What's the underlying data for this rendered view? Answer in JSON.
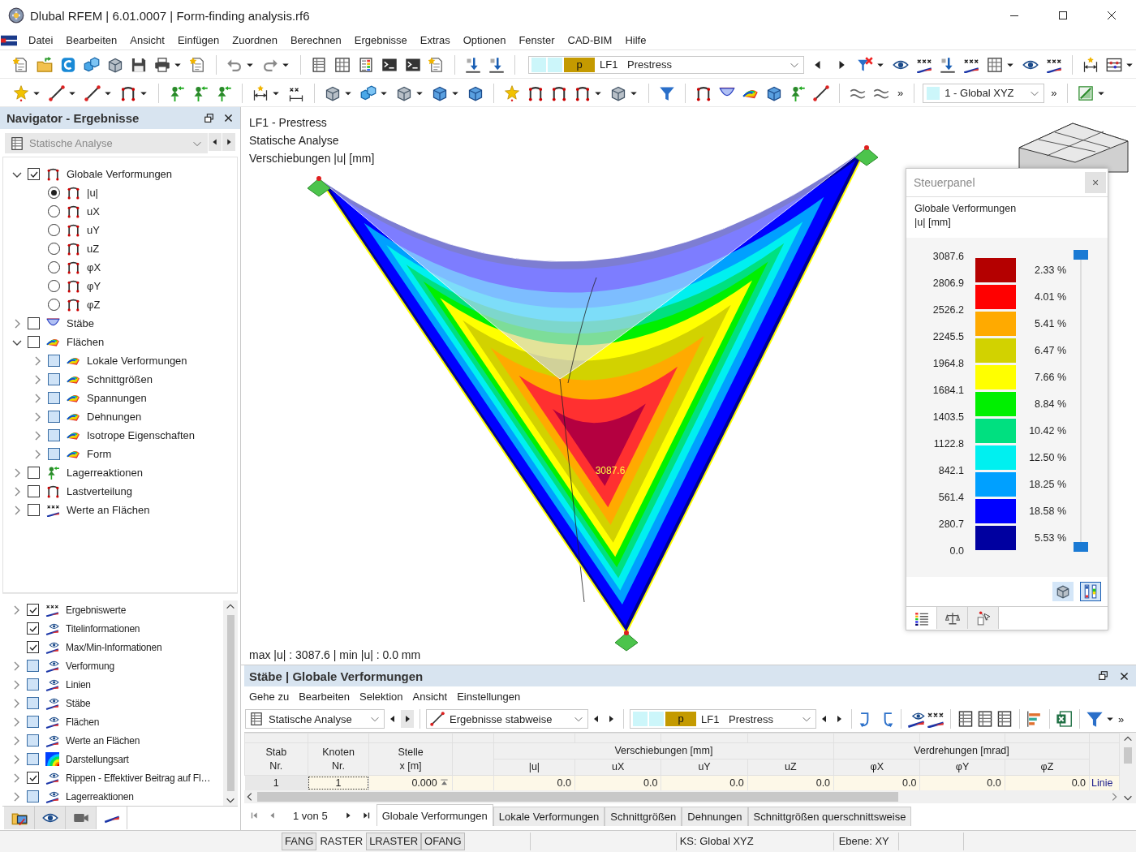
{
  "window": {
    "title": "Dlubal RFEM | 6.01.0007 | Form-finding analysis.rf6"
  },
  "menu": [
    "Datei",
    "Bearbeiten",
    "Ansicht",
    "Einfügen",
    "Zuordnen",
    "Berechnen",
    "Ergebnisse",
    "Extras",
    "Optionen",
    "Fenster",
    "CAD-BIM",
    "Hilfe"
  ],
  "toolbar_1": {
    "load_case": {
      "type": "p",
      "number": "LF1",
      "name": "Prestress"
    }
  },
  "toolbar_2": {
    "coordinate_system": "1 - Global XYZ",
    "overflow": [
      "»",
      "»"
    ]
  },
  "navigator": {
    "title": "Navigator - Ergebnisse",
    "analysis": {
      "value": "Statische Analyse",
      "disabled": true
    },
    "tree": [
      {
        "label": "Globale Verformungen",
        "kind": "deformation",
        "checked": true,
        "tinted": false,
        "expanded": true,
        "children": [
          {
            "label": "|u|",
            "kind": "deformation",
            "selected": true
          },
          {
            "label": "uX",
            "kind": "deformation",
            "selected": false
          },
          {
            "label": "uY",
            "kind": "deformation",
            "selected": false
          },
          {
            "label": "uZ",
            "kind": "deformation",
            "selected": false
          },
          {
            "label": "φX",
            "kind": "deformation",
            "selected": false
          },
          {
            "label": "φY",
            "kind": "deformation",
            "selected": false
          },
          {
            "label": "φZ",
            "kind": "deformation",
            "selected": false
          }
        ]
      },
      {
        "label": "Stäbe",
        "kind": "member",
        "checked": false,
        "tinted": false,
        "expanded": false
      },
      {
        "label": "Flächen",
        "kind": "surface",
        "checked": false,
        "tinted": false,
        "expanded": true,
        "children": [
          {
            "label": "Lokale Verformungen",
            "kind": "surface",
            "checked": false,
            "tinted": true,
            "expanded": false
          },
          {
            "label": "Schnittgrößen",
            "kind": "surface",
            "checked": false,
            "tinted": true,
            "expanded": false
          },
          {
            "label": "Spannungen",
            "kind": "surface",
            "checked": false,
            "tinted": true,
            "expanded": false
          },
          {
            "label": "Dehnungen",
            "kind": "surface",
            "checked": false,
            "tinted": true,
            "expanded": false
          },
          {
            "label": "Isotrope Eigenschaften",
            "kind": "surface",
            "checked": false,
            "tinted": true,
            "expanded": false
          },
          {
            "label": "Form",
            "kind": "surface",
            "checked": false,
            "tinted": true,
            "expanded": false
          }
        ]
      },
      {
        "label": "Lagerreaktionen",
        "kind": "support",
        "checked": false,
        "tinted": false,
        "expanded": false
      },
      {
        "label": "Lastverteilung",
        "kind": "deformation",
        "checked": false,
        "tinted": false,
        "expanded": false
      },
      {
        "label": "Werte an Flächen",
        "kind": "values",
        "checked": false,
        "tinted": false,
        "expanded": false
      }
    ],
    "display_tree": [
      {
        "label": "Ergebniswerte",
        "kind": "result-values",
        "checked": true,
        "tinted": false,
        "expanded": false
      },
      {
        "label": "Titelinformationen",
        "kind": "display",
        "checked": true,
        "tinted": false
      },
      {
        "label": "Max/Min-Informationen",
        "kind": "display",
        "checked": true,
        "tinted": false
      },
      {
        "label": "Verformung",
        "kind": "display",
        "checked": false,
        "tinted": true,
        "expanded": false
      },
      {
        "label": "Linien",
        "kind": "display",
        "checked": false,
        "tinted": true,
        "expanded": false
      },
      {
        "label": "Stäbe",
        "kind": "display",
        "checked": false,
        "tinted": true,
        "expanded": false
      },
      {
        "label": "Flächen",
        "kind": "display",
        "checked": false,
        "tinted": true,
        "expanded": false
      },
      {
        "label": "Werte an Flächen",
        "kind": "display",
        "checked": false,
        "tinted": true,
        "expanded": false
      },
      {
        "label": "Darstellungsart",
        "kind": "color-scale",
        "checked": false,
        "tinted": true,
        "expanded": false
      },
      {
        "label": "Rippen - Effektiver Beitrag auf Fl…",
        "kind": "display",
        "checked": true,
        "tinted": false,
        "expanded": false
      },
      {
        "label": "Lagerreaktionen",
        "kind": "display",
        "checked": false,
        "tinted": true,
        "expanded": false
      }
    ],
    "tabs": [
      {
        "kind": "data",
        "selected": false
      },
      {
        "kind": "view",
        "selected": false
      },
      {
        "kind": "camera",
        "selected": false
      },
      {
        "kind": "display",
        "selected": true
      }
    ]
  },
  "viewport": {
    "title_lines": [
      "LF1 - Prestress",
      "Statische Analyse",
      "Verschiebungen |u| [mm]"
    ],
    "max_label": "3087.6",
    "summary": "max |u| : 3087.6 | min |u| : 0.0 mm"
  },
  "control_panel": {
    "title": "Steuerpanel",
    "close": "×",
    "heading": "Globale Verformungen",
    "unit": "|u| [mm]",
    "values": [
      "3087.6",
      "2806.9",
      "2526.2",
      "2245.5",
      "1964.8",
      "1684.1",
      "1403.5",
      "1122.8",
      "842.1",
      "561.4",
      "280.7",
      "0.0"
    ],
    "bands": [
      {
        "color": "#b40000",
        "share": "2.33 %"
      },
      {
        "color": "#ff0000",
        "share": "4.01 %"
      },
      {
        "color": "#ffaa00",
        "share": "5.41 %"
      },
      {
        "color": "#d2d200",
        "share": "6.47 %"
      },
      {
        "color": "#ffff00",
        "share": "7.66 %"
      },
      {
        "color": "#00f000",
        "share": "8.84 %"
      },
      {
        "color": "#00e080",
        "share": "10.42 %"
      },
      {
        "color": "#00f0f0",
        "share": "12.50 %"
      },
      {
        "color": "#00a0ff",
        "share": "18.25 %"
      },
      {
        "color": "#0000ff",
        "share": "18.58 %"
      },
      {
        "color": "#0000a0",
        "share": "5.53 %"
      }
    ],
    "thumbs": [
      {
        "level": 1
      },
      {
        "level": 0
      }
    ],
    "tools": [
      {
        "kind": "box",
        "selected": false
      },
      {
        "kind": "scale",
        "selected": true
      }
    ],
    "tabs": [
      {
        "kind": "legend",
        "selected": true
      },
      {
        "kind": "balance",
        "selected": false
      },
      {
        "kind": "pointer",
        "selected": false
      }
    ]
  },
  "results_panel": {
    "title": "Stäbe | Globale Verformungen",
    "menu": [
      "Gehe zu",
      "Bearbeiten",
      "Selektion",
      "Ansicht",
      "Einstellungen"
    ],
    "analysis": "Statische Analyse",
    "mode": "Ergebnisse stabweise",
    "load_case": {
      "type": "p",
      "number": "LF1",
      "name": "Prestress"
    },
    "overflow": "»",
    "columns": [
      {
        "label": [
          "Stab",
          "Nr."
        ]
      },
      {
        "label": [
          "Knoten",
          "Nr."
        ]
      },
      {
        "label": [
          "Stelle",
          "x [m]"
        ]
      },
      {
        "kind": "blank"
      },
      {
        "group": "Verschiebungen [mm]",
        "sub": [
          "|u|",
          "uX",
          "uY",
          "uZ"
        ]
      },
      {
        "group": "Verdrehungen [mrad]",
        "sub": [
          "φX",
          "φY",
          "φZ"
        ]
      },
      {
        "kind": "blank"
      }
    ],
    "rows": [
      {
        "member": "1",
        "node": "1",
        "location": "0.000",
        "displacements": [
          "0.0",
          "0.0",
          "0.0",
          "0.0"
        ],
        "rotations": [
          "0.0",
          "0.0",
          "0.0"
        ],
        "reference": "Linie"
      }
    ],
    "pager": "1 von 5",
    "tabs": [
      {
        "label": "Globale Verformungen",
        "selected": true
      },
      {
        "label": "Lokale Verformungen",
        "selected": false
      },
      {
        "label": "Schnittgrößen",
        "selected": false
      },
      {
        "label": "Dehnungen",
        "selected": false
      },
      {
        "label": "Schnittgrößen querschnittsweise",
        "selected": false
      }
    ]
  },
  "status_bar": {
    "toggles": [
      {
        "label": "FANG",
        "on": true
      },
      {
        "label": "RASTER",
        "on": false
      },
      {
        "label": "LRASTER",
        "on": true
      },
      {
        "label": "OFANG",
        "on": true
      }
    ],
    "coordinate_system": "KS: Global XYZ",
    "plane": "Ebene: XY"
  }
}
